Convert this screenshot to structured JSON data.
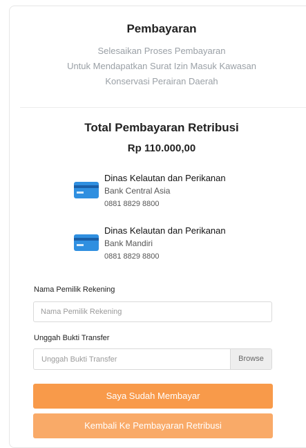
{
  "header": {
    "title": "Pembayaran",
    "subtitle_lines": [
      "Selesaikan Proses Pembayaran",
      "Untuk Mendapatkan Surat Izin Masuk Kawasan",
      "Konservasi Perairan Daerah"
    ]
  },
  "total": {
    "title": "Total Pembayaran Retribusi",
    "amount": "Rp 110.000,00"
  },
  "banks": [
    {
      "name": "Dinas Kelautan dan Perikanan",
      "bank": "Bank Central Asia",
      "account": "0881 8829 8800",
      "icon": "credit-card-icon"
    },
    {
      "name": "Dinas Kelautan dan Perikanan",
      "bank": "Bank Mandiri",
      "account": "0881 8829 8800",
      "icon": "credit-card-icon"
    }
  ],
  "form": {
    "account_name_label": "Nama Pemilik Rekening",
    "account_name_placeholder": "Nama Pemilik Rekening",
    "account_name_value": "",
    "upload_label": "Unggah Bukti Transfer",
    "upload_placeholder": "Unggah Bukti Transfer",
    "browse_label": "Browse"
  },
  "actions": {
    "primary_label": "Saya Sudah Membayar",
    "secondary_label": "Kembali Ke Pembayaran Retribusi"
  },
  "colors": {
    "accent": "#f89a4a",
    "accent_light": "#f9aa68",
    "card_icon": "#2f8fe0"
  }
}
